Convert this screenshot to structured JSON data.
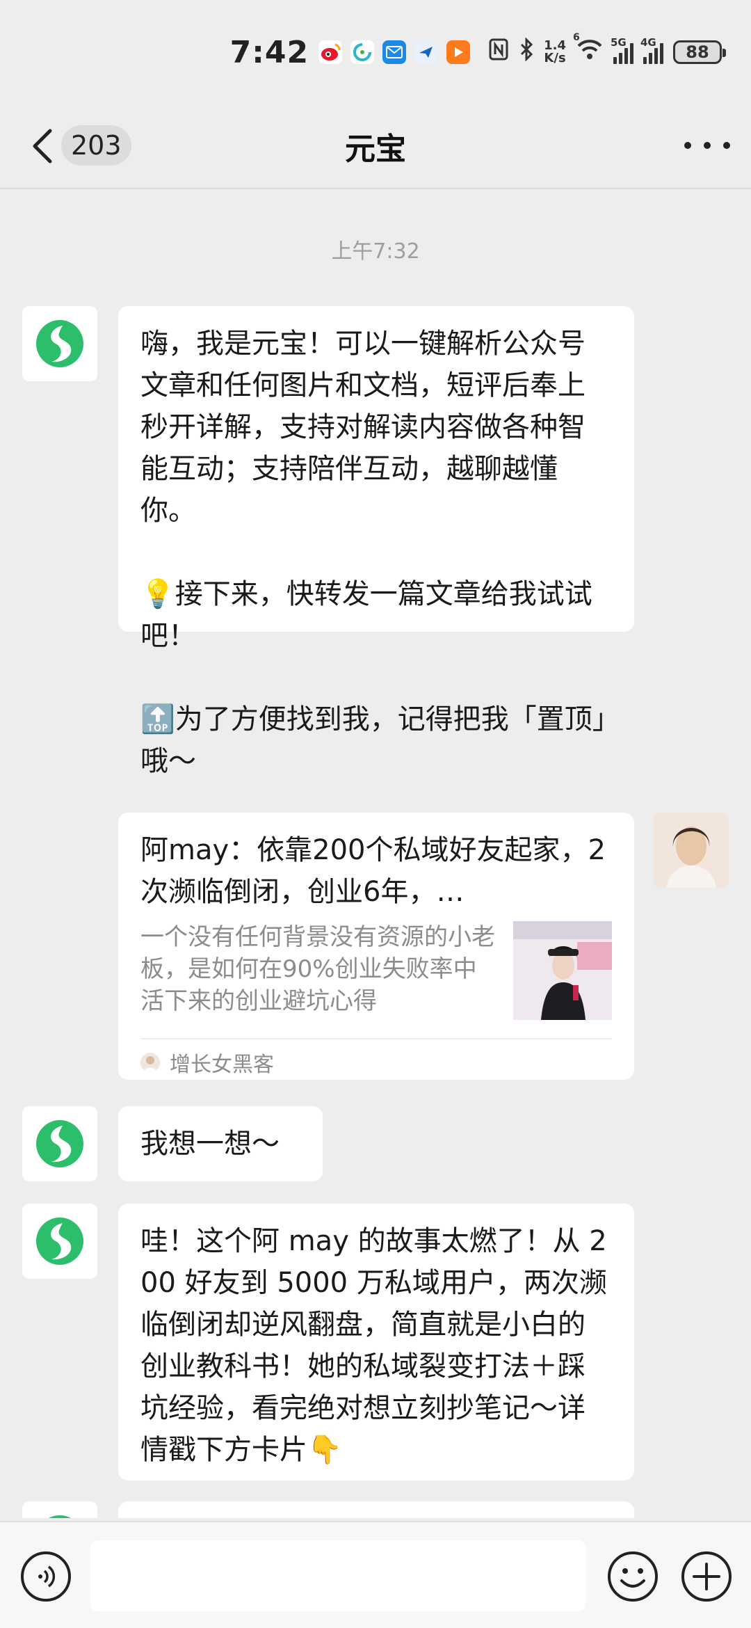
{
  "status_bar": {
    "time": "7:42",
    "net_speed_value": "1.4",
    "net_speed_unit": "K/s",
    "battery": "88",
    "sim1_tag": "5G",
    "sim2_tag": "4G",
    "wifi_tag": "6"
  },
  "header": {
    "back_badge": "203",
    "title": "元宝"
  },
  "chat": {
    "timestamp": "上午7:32",
    "messages": [
      {
        "sender": "bot",
        "lines": [
          "嗨，我是元宝！可以一键解析公众号文章和任何图片和文档，短评后奉上秒开详解，支持对解读内容做各种智能互动；支持陪伴互动，越聊越懂你。",
          "💡接下来，快转发一篇文章给我试试吧！",
          "🔝为了方便找到我，记得把我「置顶」哦～"
        ]
      },
      {
        "sender": "user",
        "card": {
          "title": "阿may：依靠200个私域好友起家，2次濒临倒闭，创业6年，…",
          "description": "一个没有任何背景没有资源的小老板，是如何在90%创业失败率中活下来的创业避坑心得",
          "source": "增长女黑客"
        }
      },
      {
        "sender": "bot",
        "text": "我想一想～"
      },
      {
        "sender": "bot",
        "text": "哇！这个阿 may 的故事太燃了！从 200 好友到 5000 万私域用户，两次濒临倒闭却逆风翻盘，简直就是小白的创业教科书！她的私域裂变打法＋踩坑经验，看完绝对想立刻抄笔记～详情戳下方卡片👇"
      }
    ]
  },
  "input_bar": {
    "placeholder": ""
  },
  "colors": {
    "background": "#EDEDED",
    "bubble": "#FFFFFF",
    "bot_logo_green": "#2DBE6C",
    "timestamp": "#9E9E9E"
  },
  "icons": [
    "back-chevron-icon",
    "more-dots-icon",
    "yuanbao-logo-icon",
    "voice-icon",
    "emoji-icon",
    "plus-icon"
  ]
}
